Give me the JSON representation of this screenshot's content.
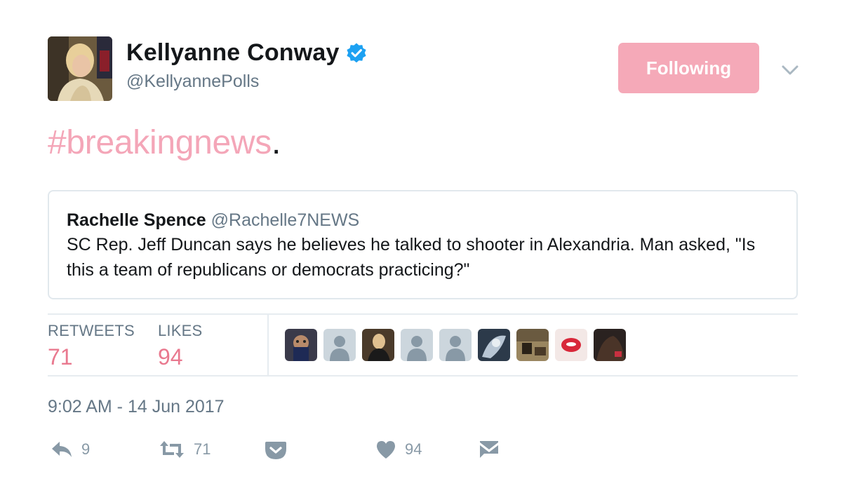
{
  "header": {
    "display_name": "Kellyanne Conway",
    "handle": "@KellyannePolls",
    "follow_label": "Following"
  },
  "tweet": {
    "hashtag": "#breakingnews",
    "trailing": "."
  },
  "quoted_tweet": {
    "author_name": "Rachelle Spence",
    "author_handle": "@Rachelle7NEWS",
    "text": "SC Rep. Jeff Duncan says he believes he talked to shooter in Alexandria. Man asked, \"Is this a team of republicans or democrats practicing?\""
  },
  "stats": {
    "retweets_label": "RETWEETS",
    "retweets_value": "71",
    "likes_label": "LIKES",
    "likes_value": "94"
  },
  "timestamp": "9:02 AM - 14 Jun 2017",
  "actions": {
    "reply_count": "9",
    "retweet_count": "71",
    "like_count": "94"
  },
  "colors": {
    "accent_pink": "#f5a9b8",
    "hashtag_pink": "#f4a6b8",
    "stat_pink": "#e9798f",
    "verified_blue": "#1da1f2",
    "muted_gray": "#657786"
  }
}
